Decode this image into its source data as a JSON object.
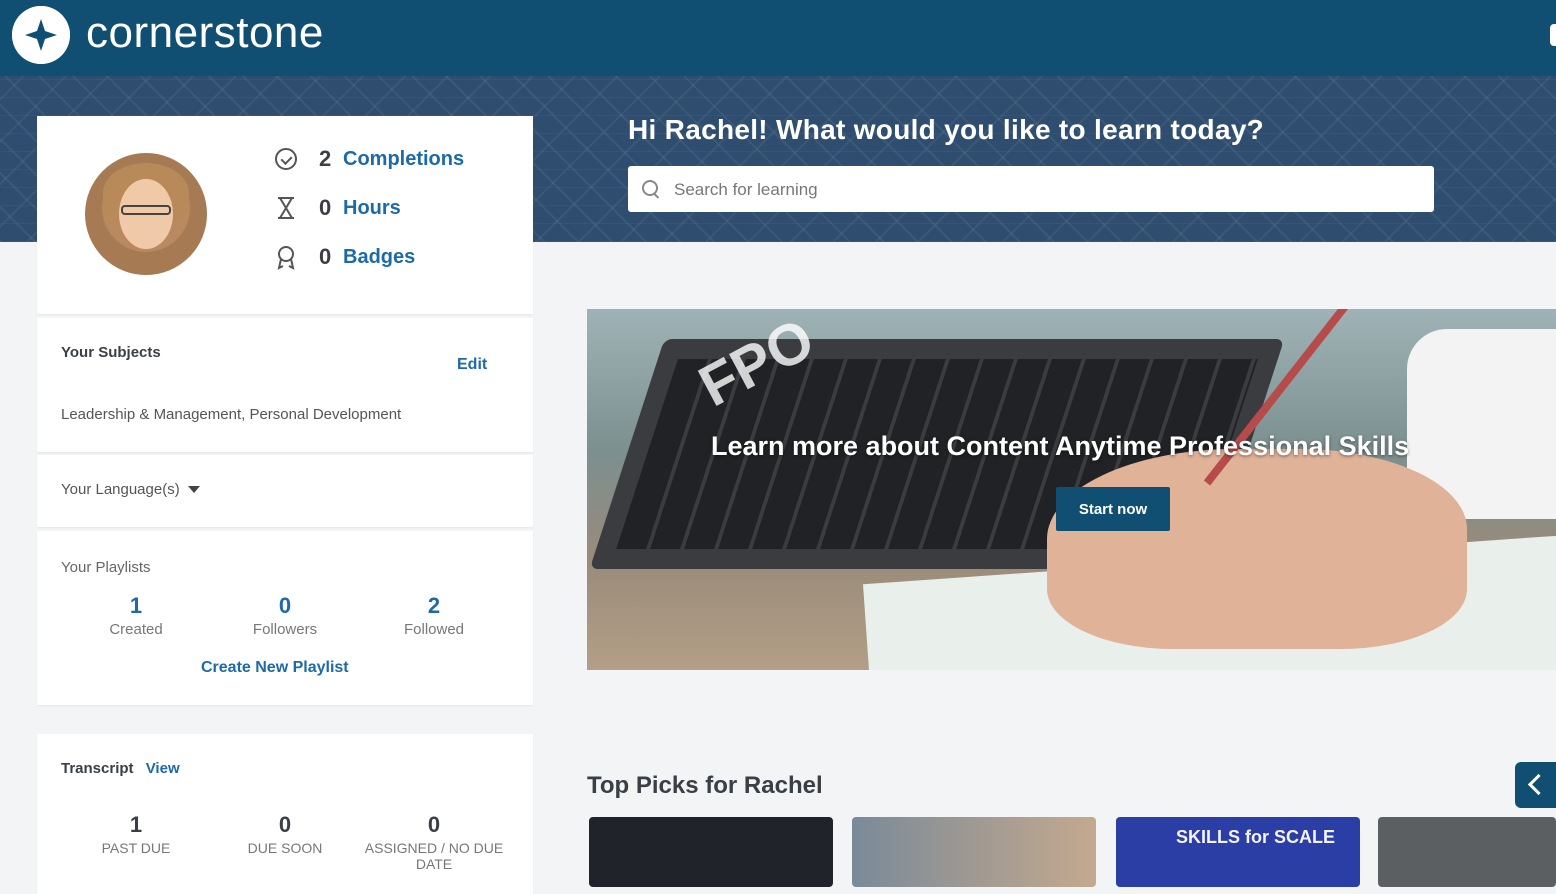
{
  "header": {
    "brand": "cornerstone"
  },
  "hero": {
    "greeting": "Hi Rachel! What would you like to learn today?",
    "search_placeholder": "Search for learning"
  },
  "profile": {
    "stats": [
      {
        "value": "2",
        "label": "Completions",
        "icon": "check-circle-icon"
      },
      {
        "value": "0",
        "label": "Hours",
        "icon": "hourglass-icon"
      },
      {
        "value": "0",
        "label": "Badges",
        "icon": "badge-icon"
      }
    ]
  },
  "subjects": {
    "title": "Your Subjects",
    "edit_label": "Edit",
    "list": "Leadership & Management, Personal Development"
  },
  "language": {
    "label": "Your Language(s)"
  },
  "playlists": {
    "title": "Your Playlists",
    "counts": [
      {
        "value": "1",
        "label": "Created"
      },
      {
        "value": "0",
        "label": "Followers"
      },
      {
        "value": "2",
        "label": "Followed"
      }
    ],
    "create_label": "Create New Playlist"
  },
  "transcript": {
    "title": "Transcript",
    "view_label": "View",
    "counts": [
      {
        "value": "1",
        "label": "PAST DUE"
      },
      {
        "value": "0",
        "label": "DUE SOON"
      },
      {
        "value": "0",
        "label": "ASSIGNED / NO DUE DATE"
      }
    ]
  },
  "banner": {
    "watermark": "FPO",
    "title": "Learn more about Content Anytime Professional Skills",
    "button_label": "Start now"
  },
  "top_picks": {
    "title": "Top Picks for Rachel",
    "tile3_text": "SKILLS for SCALE"
  },
  "colors": {
    "brand": "#114f72",
    "link": "#1c6aa8"
  }
}
